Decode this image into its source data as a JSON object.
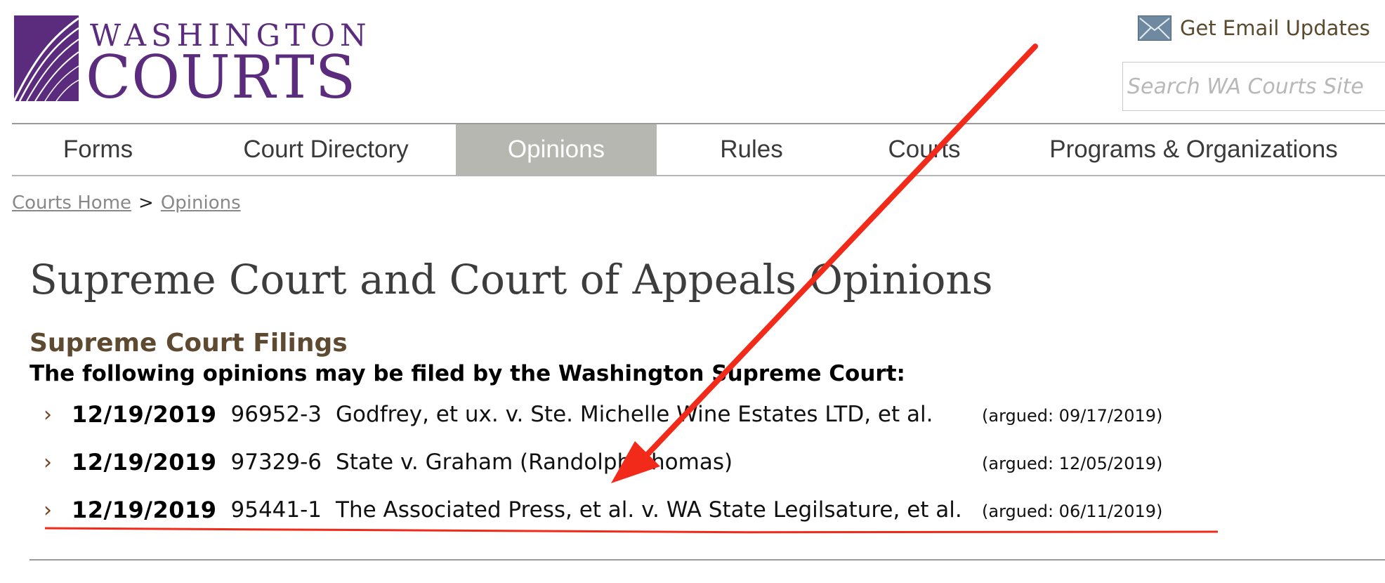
{
  "header": {
    "logo_line1": "WASHINGTON",
    "logo_line2": "COURTS",
    "email_label": "Get Email Updates",
    "search_placeholder": "Search WA Courts Site"
  },
  "nav": {
    "items": [
      {
        "label": "Forms"
      },
      {
        "label": "Court Directory"
      },
      {
        "label": "Opinions",
        "active": true
      },
      {
        "label": "Rules"
      },
      {
        "label": "Courts"
      },
      {
        "label": "Programs & Organizations"
      }
    ],
    "active_bg": "#b7b7b1"
  },
  "breadcrumb": {
    "home": "Courts Home",
    "separator": ">",
    "current": "Opinions"
  },
  "main": {
    "title": "Supreme Court and Court of Appeals Opinions",
    "section_title": "Supreme Court Filings",
    "intro": "The following opinions may be filed by the Washington Supreme Court:",
    "filings": [
      {
        "date": "12/19/2019",
        "number": "96952-3",
        "title": "Godfrey, et ux. v. Ste. Michelle Wine Estates LTD, et al.",
        "argued": "(argued: 09/17/2019)"
      },
      {
        "date": "12/19/2019",
        "number": "97329-6",
        "title": "State v. Graham (Randolph Thomas)",
        "argued": "(argued: 12/05/2019)"
      },
      {
        "date": "12/19/2019",
        "number": "95441-1",
        "title": "The Associated Press, et al. v. WA State Legilsature, et al.",
        "argued": "(argued: 06/11/2019)"
      }
    ]
  },
  "colors": {
    "brand_purple": "#5b2b7e",
    "section_brown": "#5d4a30",
    "annotation_red": "#f22a1a"
  }
}
